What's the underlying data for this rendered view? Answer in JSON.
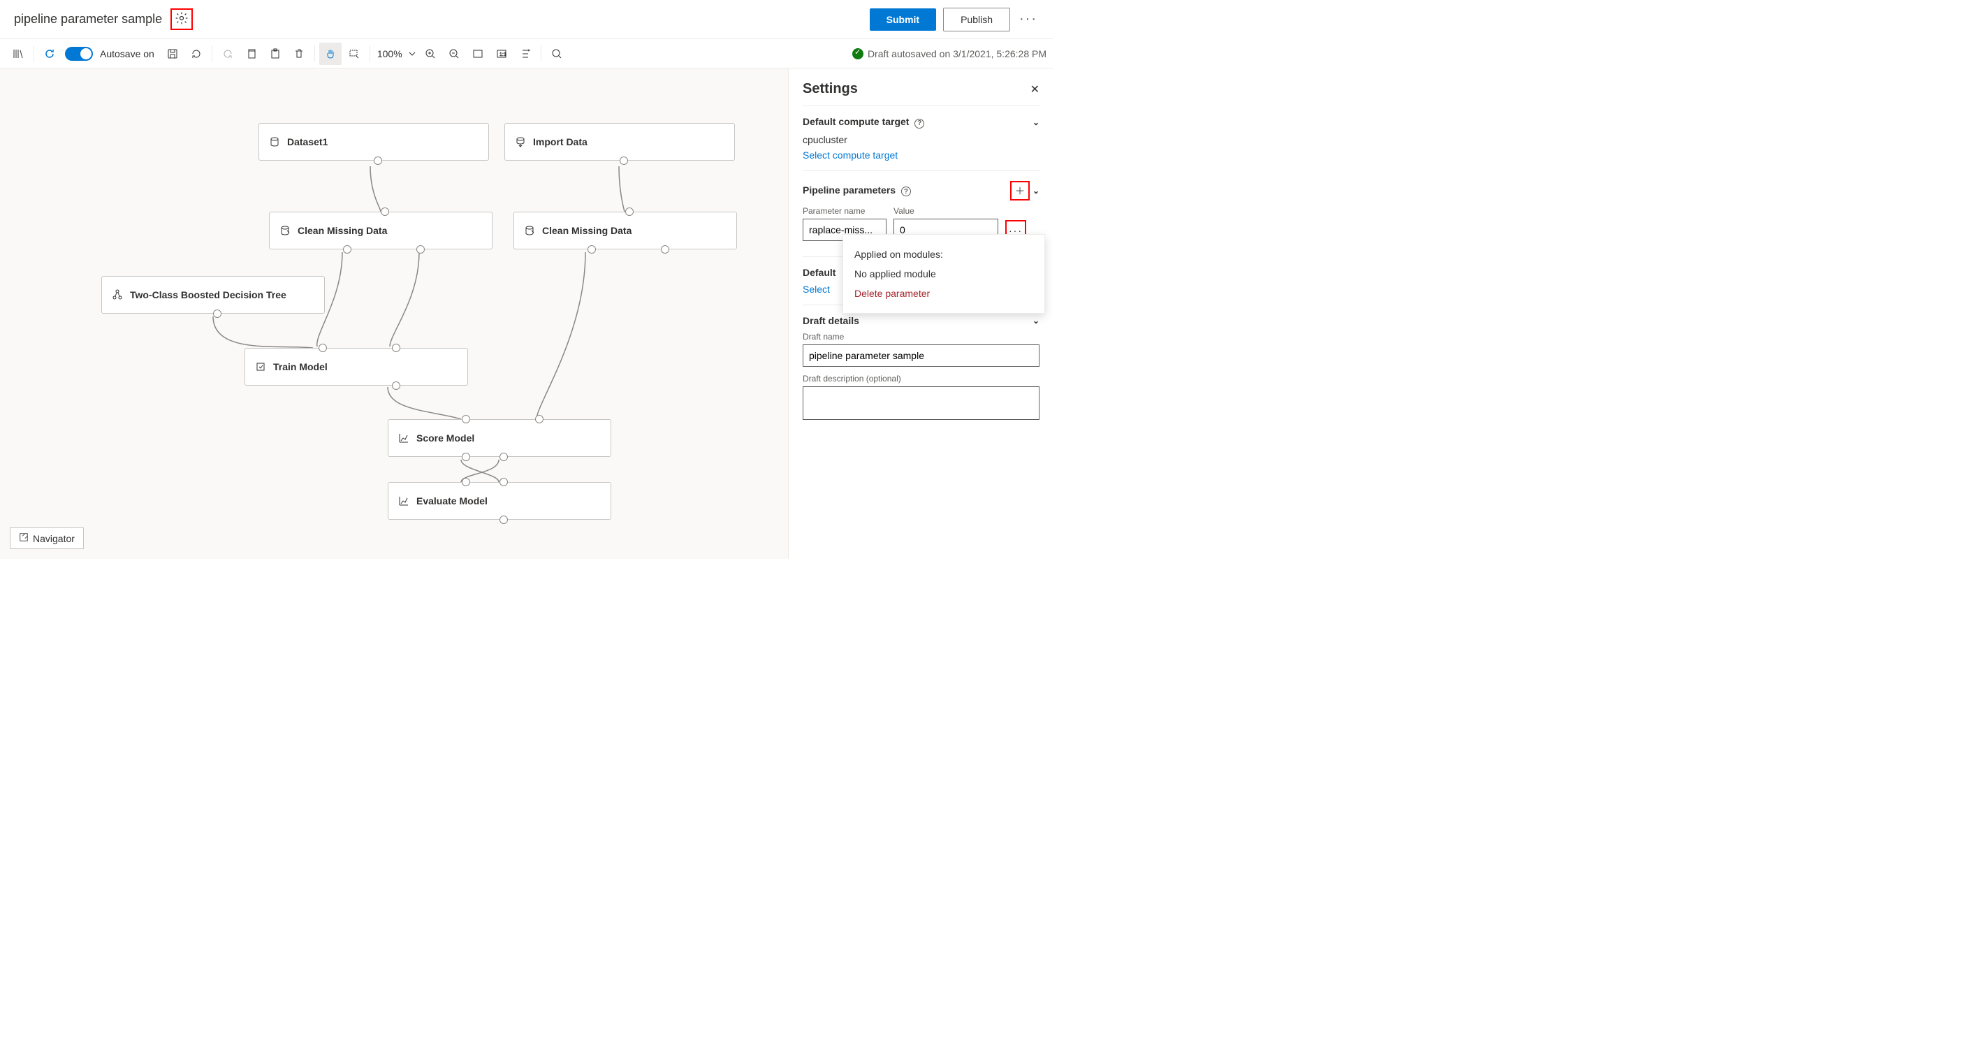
{
  "header": {
    "title": "pipeline parameter sample",
    "submit": "Submit",
    "publish": "Publish"
  },
  "toolbar": {
    "autosave_label": "Autosave on",
    "zoom": "100%",
    "status": "Draft autosaved on 3/1/2021, 5:26:28 PM"
  },
  "nodes": {
    "dataset1": "Dataset1",
    "import_data": "Import Data",
    "clean1": "Clean Missing Data",
    "clean2": "Clean Missing Data",
    "tree": "Two-Class Boosted Decision Tree",
    "train": "Train Model",
    "score": "Score Model",
    "evaluate": "Evaluate Model"
  },
  "navigator": "Navigator",
  "panel": {
    "title": "Settings",
    "compute_header": "Default compute target",
    "compute_value": "cpucluster",
    "compute_link": "Select compute target",
    "params_header": "Pipeline parameters",
    "param_name_label": "Parameter name",
    "param_value_label": "Value",
    "param_name": "raplace-miss...",
    "param_value": "0",
    "popup_applied": "Applied on modules:",
    "popup_none": "No applied module",
    "popup_delete": "Delete parameter",
    "default_ds_short": "Default",
    "select_short": "Select",
    "draft_header": "Draft details",
    "draft_name_label": "Draft name",
    "draft_name": "pipeline parameter sample",
    "draft_desc_label": "Draft description (optional)"
  }
}
